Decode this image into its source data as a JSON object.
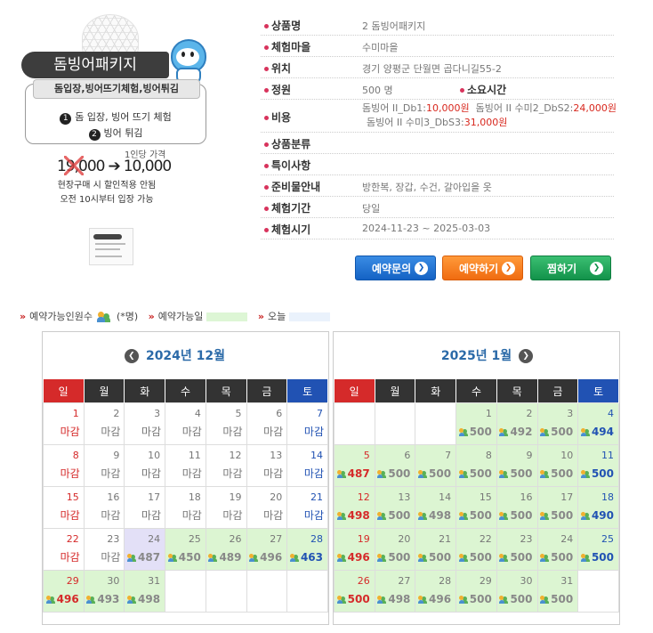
{
  "promo": {
    "title": "돔빙어패키지",
    "box_head": "돔입장,빙어뜨기체험,빙어튀김",
    "item1_num": "1",
    "item1": "돔 입장, 빙어 뜨기 체험",
    "item2_num": "2",
    "item2": "빙어 튀김",
    "price_label": "1인당 가격",
    "old_price": "19,000",
    "arrow": "➔",
    "new_price": "10,000",
    "note1": "현장구매 시 할인적용 안됨",
    "note2": "오전 10시부터 입장 가능"
  },
  "info": {
    "rows": [
      {
        "label": "상품명",
        "value": "2 돔빙어패키지"
      },
      {
        "label": "체험마을",
        "value": "수미마을"
      },
      {
        "label": "위치",
        "value": "경기 양평군 단월면 곱다니길55-2"
      },
      {
        "label": "정원",
        "value": "500 명",
        "sub_label": "소요시간",
        "sub_value": ""
      },
      {
        "label": "비용"
      },
      {
        "label": "상품분류",
        "value": ""
      },
      {
        "label": "특이사항",
        "value": ""
      },
      {
        "label": "준비물안내",
        "value": "방한복, 장갑, 수건, 갈아입을 옷"
      },
      {
        "label": "체험기간",
        "value": "당일"
      },
      {
        "label": "체험시기",
        "value": "2024-11-23 ~ 2025-03-03"
      }
    ],
    "cost": {
      "a_name": "돔빙어 II_Db1:",
      "a_price": "10,000원",
      "b_name": "돔빙어 II 수미2_DbS2:",
      "b_price": "24,000원",
      "c_name": "돔빙어 II 수미3_DbS3:",
      "c_price": "31,000원"
    }
  },
  "buttons": {
    "inquiry": "예약문의",
    "reserve": "예약하기",
    "wish": "찜하기",
    "arrow": "❯"
  },
  "legend": {
    "mark": "»",
    "people": "예약가능인원수",
    "people_unit": "(*명)",
    "available": "예약가능일",
    "today": "오늘"
  },
  "calendars": [
    {
      "title": "2024년 12월",
      "nav": "❮",
      "weekdays": [
        "일",
        "월",
        "화",
        "수",
        "목",
        "금",
        "토"
      ],
      "weeks": [
        [
          {
            "d": "1",
            "s": "마감"
          },
          {
            "d": "2",
            "s": "마감"
          },
          {
            "d": "3",
            "s": "마감"
          },
          {
            "d": "4",
            "s": "마감"
          },
          {
            "d": "5",
            "s": "마감"
          },
          {
            "d": "6",
            "s": "마감"
          },
          {
            "d": "7",
            "s": "마감"
          }
        ],
        [
          {
            "d": "8",
            "s": "마감"
          },
          {
            "d": "9",
            "s": "마감"
          },
          {
            "d": "10",
            "s": "마감"
          },
          {
            "d": "11",
            "s": "마감"
          },
          {
            "d": "12",
            "s": "마감"
          },
          {
            "d": "13",
            "s": "마감"
          },
          {
            "d": "14",
            "s": "마감"
          }
        ],
        [
          {
            "d": "15",
            "s": "마감"
          },
          {
            "d": "16",
            "s": "마감"
          },
          {
            "d": "17",
            "s": "마감"
          },
          {
            "d": "18",
            "s": "마감"
          },
          {
            "d": "19",
            "s": "마감"
          },
          {
            "d": "20",
            "s": "마감"
          },
          {
            "d": "21",
            "s": "마감"
          }
        ],
        [
          {
            "d": "22",
            "s": "마감"
          },
          {
            "d": "23",
            "s": "마감"
          },
          {
            "d": "24",
            "c": "487",
            "today": true
          },
          {
            "d": "25",
            "c": "450"
          },
          {
            "d": "26",
            "c": "489"
          },
          {
            "d": "27",
            "c": "496"
          },
          {
            "d": "28",
            "c": "463"
          }
        ],
        [
          {
            "d": "29",
            "c": "496"
          },
          {
            "d": "30",
            "c": "493"
          },
          {
            "d": "31",
            "c": "498"
          },
          {},
          {},
          {},
          {}
        ]
      ]
    },
    {
      "title": "2025년 1월",
      "nav": "❯",
      "weekdays": [
        "일",
        "월",
        "화",
        "수",
        "목",
        "금",
        "토"
      ],
      "weeks": [
        [
          {},
          {},
          {},
          {
            "d": "1",
            "c": "500"
          },
          {
            "d": "2",
            "c": "492"
          },
          {
            "d": "3",
            "c": "500"
          },
          {
            "d": "4",
            "c": "494"
          }
        ],
        [
          {
            "d": "5",
            "c": "487"
          },
          {
            "d": "6",
            "c": "500"
          },
          {
            "d": "7",
            "c": "500"
          },
          {
            "d": "8",
            "c": "500"
          },
          {
            "d": "9",
            "c": "500"
          },
          {
            "d": "10",
            "c": "500"
          },
          {
            "d": "11",
            "c": "500"
          }
        ],
        [
          {
            "d": "12",
            "c": "498"
          },
          {
            "d": "13",
            "c": "500"
          },
          {
            "d": "14",
            "c": "498"
          },
          {
            "d": "15",
            "c": "500"
          },
          {
            "d": "16",
            "c": "500"
          },
          {
            "d": "17",
            "c": "500"
          },
          {
            "d": "18",
            "c": "490"
          }
        ],
        [
          {
            "d": "19",
            "c": "496"
          },
          {
            "d": "20",
            "c": "500"
          },
          {
            "d": "21",
            "c": "500"
          },
          {
            "d": "22",
            "c": "500"
          },
          {
            "d": "23",
            "c": "500"
          },
          {
            "d": "24",
            "c": "500"
          },
          {
            "d": "25",
            "c": "500"
          }
        ],
        [
          {
            "d": "26",
            "c": "500"
          },
          {
            "d": "27",
            "c": "498"
          },
          {
            "d": "28",
            "c": "496"
          },
          {
            "d": "29",
            "c": "500"
          },
          {
            "d": "30",
            "c": "500"
          },
          {
            "d": "31",
            "c": "500"
          },
          {}
        ]
      ]
    }
  ]
}
